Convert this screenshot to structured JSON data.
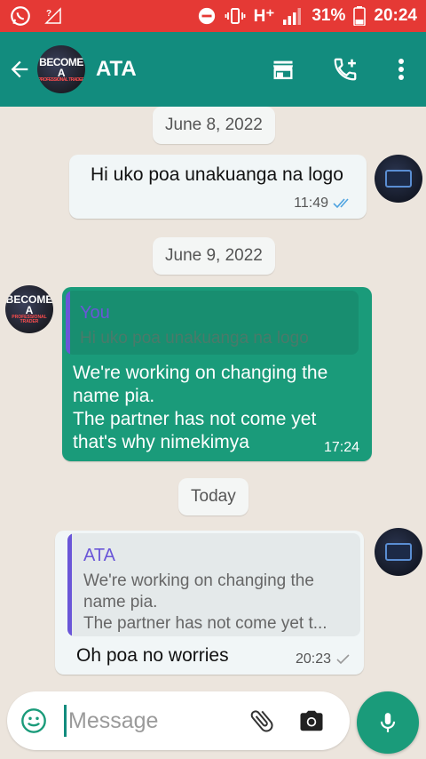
{
  "status_bar": {
    "battery": "31%",
    "time": "20:24",
    "network": "H⁺"
  },
  "header": {
    "contact_name": "ATA",
    "avatar_text": "BECOME A",
    "avatar_subtext": "PROFESSIONAL TRADER"
  },
  "chat": {
    "date_1": "June 8, 2022",
    "date_2": "June 9, 2022",
    "date_3": "Today",
    "msg1": {
      "text": "Hi uko poa unakuanga na logo",
      "time": "11:49"
    },
    "msg2": {
      "quote_name": "You",
      "quote_text": "Hi uko poa unakuanga na logo",
      "line1": "We're working on changing the",
      "line2": "name pia.",
      "line3": "The partner has not come yet",
      "line4": "that's why nimekimya",
      "time": "17:24"
    },
    "msg3": {
      "quote_name": "ATA",
      "quote_line1": "We're working on changing the",
      "quote_line2": "name pia.",
      "quote_line3": "The partner has not come yet t...",
      "text": "Oh poa no worries",
      "time": "20:23"
    }
  },
  "input": {
    "placeholder": "Message"
  },
  "colors": {
    "accent": "#128c7e",
    "status_bar": "#e53935",
    "quote_accent": "#6a56d8",
    "read_ticks": "#4fa3e0"
  }
}
